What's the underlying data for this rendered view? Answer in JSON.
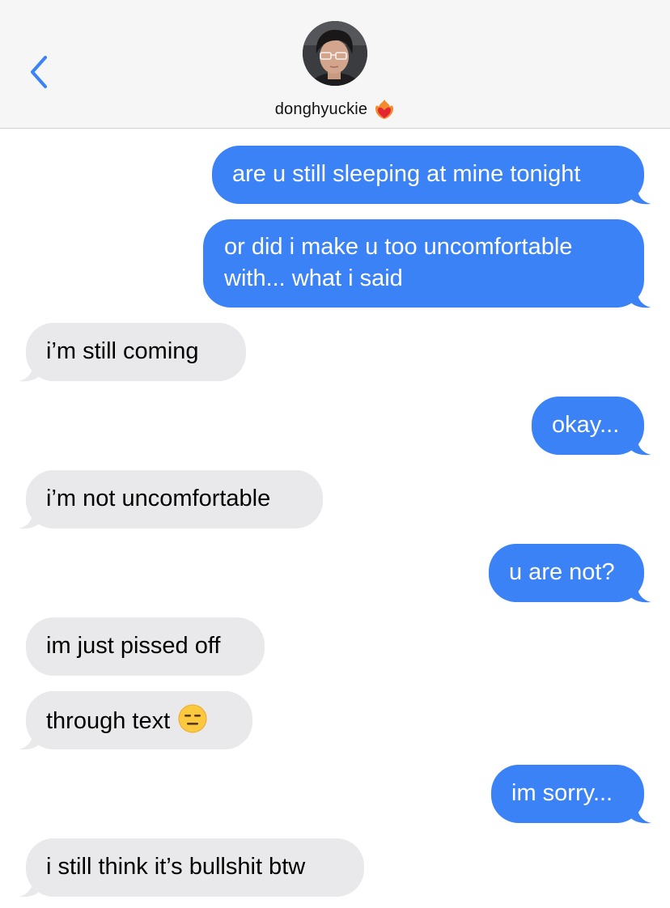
{
  "header": {
    "back_label": "Back",
    "contact_name": "donghyuckie",
    "heart_icon": "heart-on-fire-emoji",
    "avatar_icon": "contact-avatar"
  },
  "colors": {
    "outgoing": "#3a82f6",
    "incoming": "#e9e9eb",
    "accent": "#3a82f6"
  },
  "messages": [
    {
      "dir": "out",
      "text": "are u still sleeping at mine tonight"
    },
    {
      "dir": "out",
      "line1": "or did i make u too uncomfortable",
      "line2": "with... what i said"
    },
    {
      "dir": "in",
      "text": "i’m still coming"
    },
    {
      "dir": "out",
      "text": "okay..."
    },
    {
      "dir": "in",
      "text": "i’m not uncomfortable"
    },
    {
      "dir": "out",
      "text": "u are not?"
    },
    {
      "dir": "in",
      "text": "im just pissed off"
    },
    {
      "dir": "in",
      "text": "through text",
      "emoji": "expressionless-face-emoji"
    },
    {
      "dir": "out",
      "text": "im sorry..."
    },
    {
      "dir": "in",
      "text": "i still think it’s bullshit btw"
    }
  ]
}
